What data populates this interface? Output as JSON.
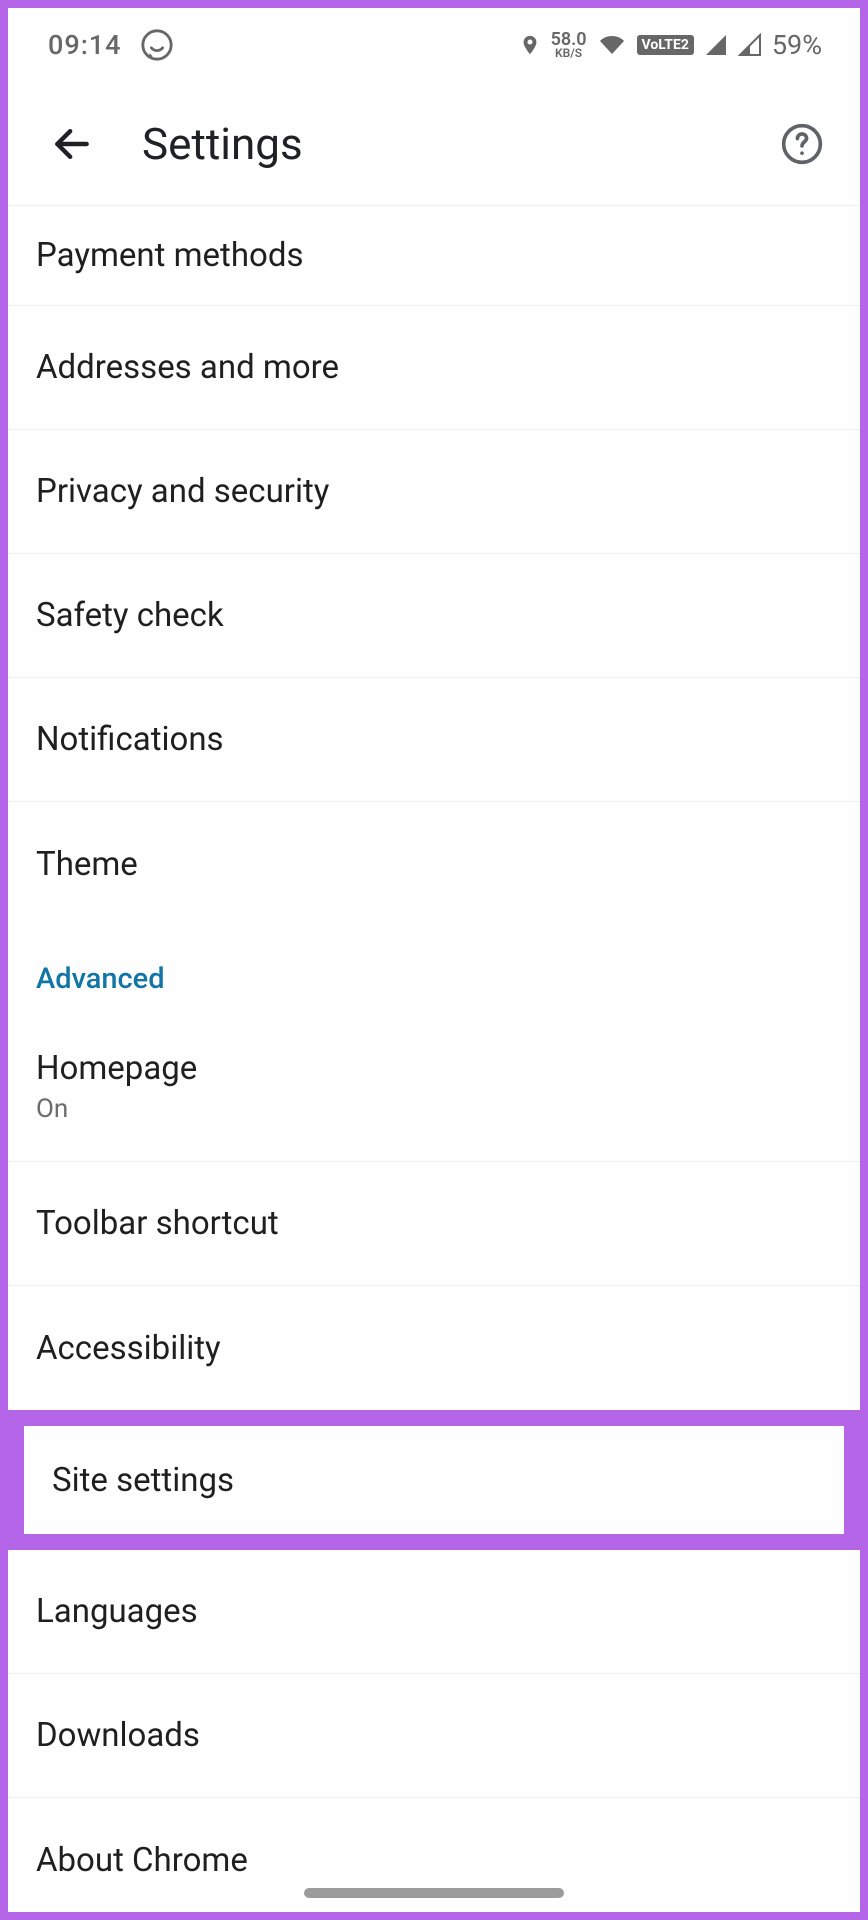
{
  "status": {
    "time": "09:14",
    "kbs_top": "58.0",
    "kbs_bot": "KB/S",
    "volte": "VoLTE2",
    "battery": "59%"
  },
  "appbar": {
    "title": "Settings"
  },
  "section_header": "Advanced",
  "rows": {
    "payment": "Payment methods",
    "addresses": "Addresses and more",
    "privacy": "Privacy and security",
    "safety": "Safety check",
    "notifications": "Notifications",
    "theme": "Theme",
    "homepage_label": "Homepage",
    "homepage_sub": "On",
    "toolbar": "Toolbar shortcut",
    "accessibility": "Accessibility",
    "site_settings": "Site settings",
    "languages": "Languages",
    "downloads": "Downloads",
    "about": "About Chrome"
  }
}
